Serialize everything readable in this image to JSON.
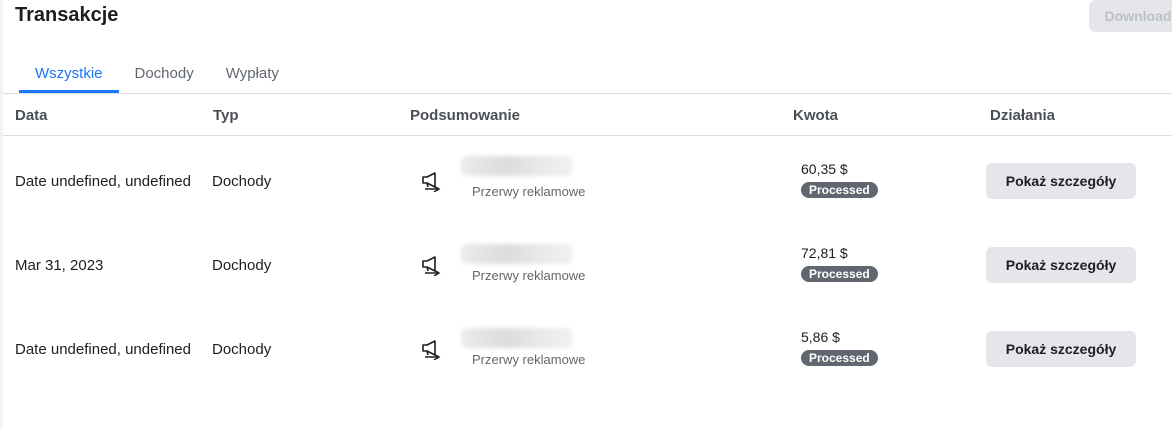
{
  "header": {
    "title": "Transakcje",
    "download_label": "Download"
  },
  "tabs": [
    {
      "label": "Wszystkie",
      "active": true
    },
    {
      "label": "Dochody",
      "active": false
    },
    {
      "label": "Wypłaty",
      "active": false
    }
  ],
  "table": {
    "columns": [
      "Data",
      "Typ",
      "Podsumowanie",
      "Kwota",
      "Działania"
    ],
    "rows": [
      {
        "date": "Date undefined, undefined",
        "type": "Dochody",
        "summary_sub": "Przerwy reklamowe",
        "icon": "megaphone-icon",
        "amount": "60,35 $",
        "status": "Processed",
        "action": "Pokaż szczegóły"
      },
      {
        "date": "Mar 31, 2023",
        "type": "Dochody",
        "summary_sub": "Przerwy reklamowe",
        "icon": "megaphone-icon",
        "amount": "72,81 $",
        "status": "Processed",
        "action": "Pokaż szczegóły"
      },
      {
        "date": "Date undefined, undefined",
        "type": "Dochody",
        "summary_sub": "Przerwy reklamowe",
        "icon": "megaphone-icon",
        "amount": "5,86 $",
        "status": "Processed",
        "action": "Pokaż szczegóły"
      }
    ]
  },
  "colors": {
    "accent": "#1877f2",
    "badge": "#606770",
    "button_bg": "#e4e6eb"
  }
}
